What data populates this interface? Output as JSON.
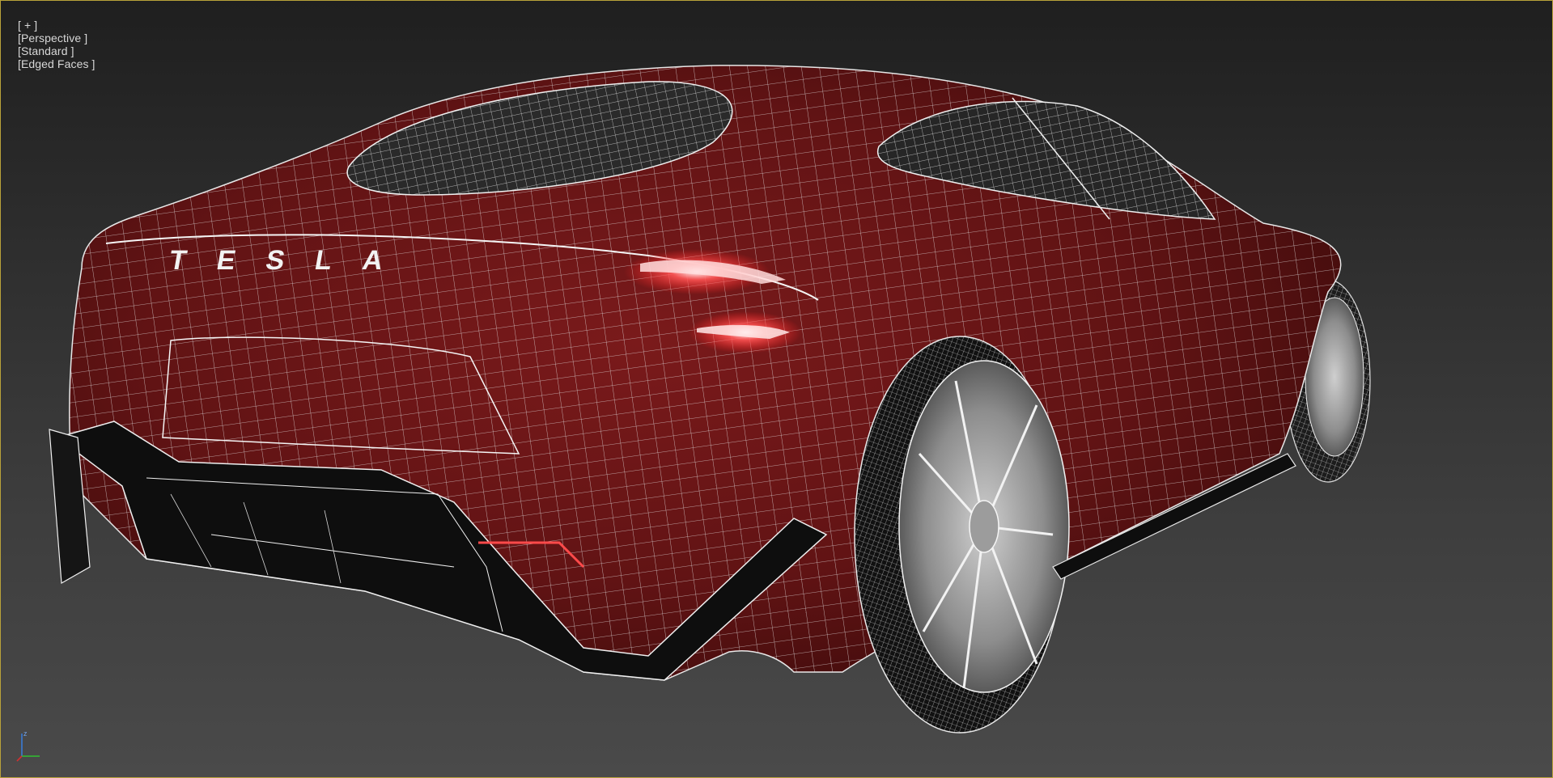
{
  "viewport": {
    "label_menus": [
      {
        "id": "plus",
        "text": "[ + ]"
      },
      {
        "id": "view",
        "text": "[Perspective ]"
      },
      {
        "id": "shading",
        "text": "[Standard ]"
      },
      {
        "id": "edges",
        "text": "[Edged Faces ]"
      }
    ],
    "active_border_color": "#b9a23a",
    "background_top": "#1f1f1f",
    "background_bottom": "#4a4a4a"
  },
  "model": {
    "body_color": "#6b1516",
    "wire_color": "#e8e8e8",
    "badge_text": "TESLA",
    "taillight_color": "#ff3030"
  },
  "axis_gizmo": {
    "z_label": "z",
    "colors": {
      "x": "#d03030",
      "y": "#30c030",
      "z": "#3a7bd5"
    }
  }
}
